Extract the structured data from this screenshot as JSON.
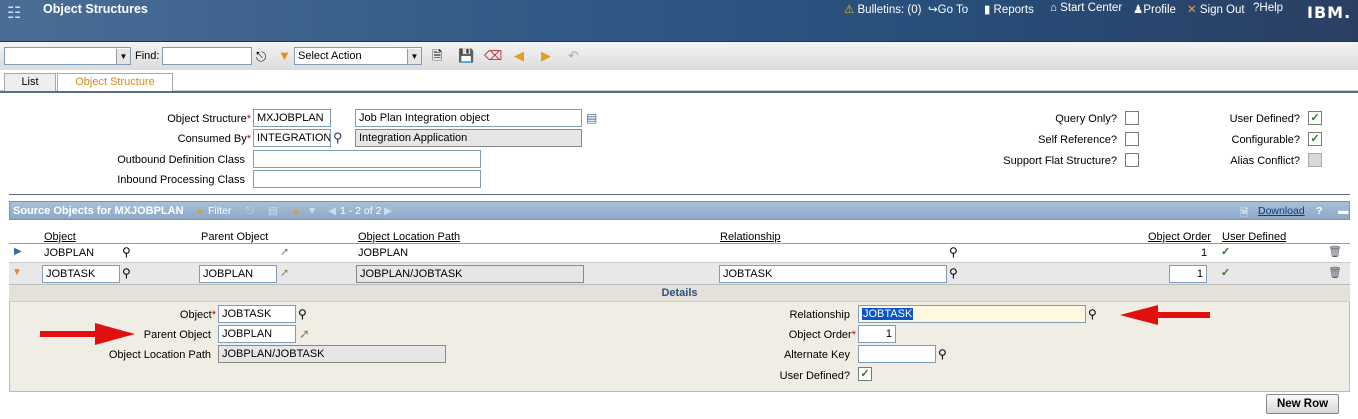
{
  "header": {
    "title": "Object Structures",
    "nav": {
      "bulletins": "Bulletins: (0)",
      "goto": "Go To",
      "reports": "Reports",
      "start_center": "Start Center",
      "profile": "Profile",
      "sign_out": "Sign Out",
      "help": "Help"
    },
    "logo": "IBM."
  },
  "toolbar": {
    "find_label": "Find:",
    "find_value": "",
    "select_action": "Select Action"
  },
  "tabs": [
    {
      "label": "List",
      "active": false
    },
    {
      "label": "Object Structure",
      "active": true
    }
  ],
  "form": {
    "object_structure_label": "Object Structure",
    "object_structure_value": "MXJOBPLAN",
    "object_structure_desc": "Job Plan Integration object",
    "consumed_by_label": "Consumed By",
    "consumed_by_value": "INTEGRATION",
    "consumed_by_desc": "Integration Application",
    "outbound_label": "Outbound Definition Class",
    "outbound_value": "",
    "inbound_label": "Inbound Processing Class",
    "inbound_value": "",
    "query_only_label": "Query Only?",
    "self_reference_label": "Self Reference?",
    "support_flat_label": "Support Flat Structure?",
    "user_defined_label": "User Defined?",
    "configurable_label": "Configurable?",
    "alias_conflict_label": "Alias Conflict?",
    "query_only": false,
    "self_reference": false,
    "support_flat": false,
    "user_defined": true,
    "configurable": true,
    "alias_conflict": false
  },
  "source_objects": {
    "title": "Source Objects for MXJOBPLAN",
    "filter": "Filter",
    "paging": "1 - 2 of 2",
    "download": "Download",
    "help": "?",
    "columns": [
      "Object",
      "Parent Object",
      "Object Location Path",
      "Relationship",
      "Object Order",
      "User Defined"
    ],
    "rows": [
      {
        "object": "JOBPLAN",
        "parent": "",
        "path": "JOBPLAN",
        "relationship": "",
        "order": "1",
        "user_defined": true
      },
      {
        "object": "JOBTASK",
        "parent": "JOBPLAN",
        "path": "JOBPLAN/JOBTASK",
        "relationship": "JOBTASK",
        "order": "1",
        "user_defined": true
      }
    ]
  },
  "details": {
    "title": "Details",
    "object_label": "Object",
    "object_value": "JOBTASK",
    "parent_label": "Parent Object",
    "parent_value": "JOBPLAN",
    "path_label": "Object Location Path",
    "path_value": "JOBPLAN/JOBTASK",
    "relationship_label": "Relationship",
    "relationship_value": "JOBTASK",
    "order_label": "Object Order",
    "order_value": "1",
    "alt_key_label": "Alternate Key",
    "alt_key_value": "",
    "user_defined_label": "User Defined?",
    "user_defined": true
  },
  "new_row": "New Row",
  "colors": {
    "header": "#315a86",
    "section": "#8ea8c6",
    "arrow": "#e01010",
    "tab_active": "#d7891a"
  }
}
